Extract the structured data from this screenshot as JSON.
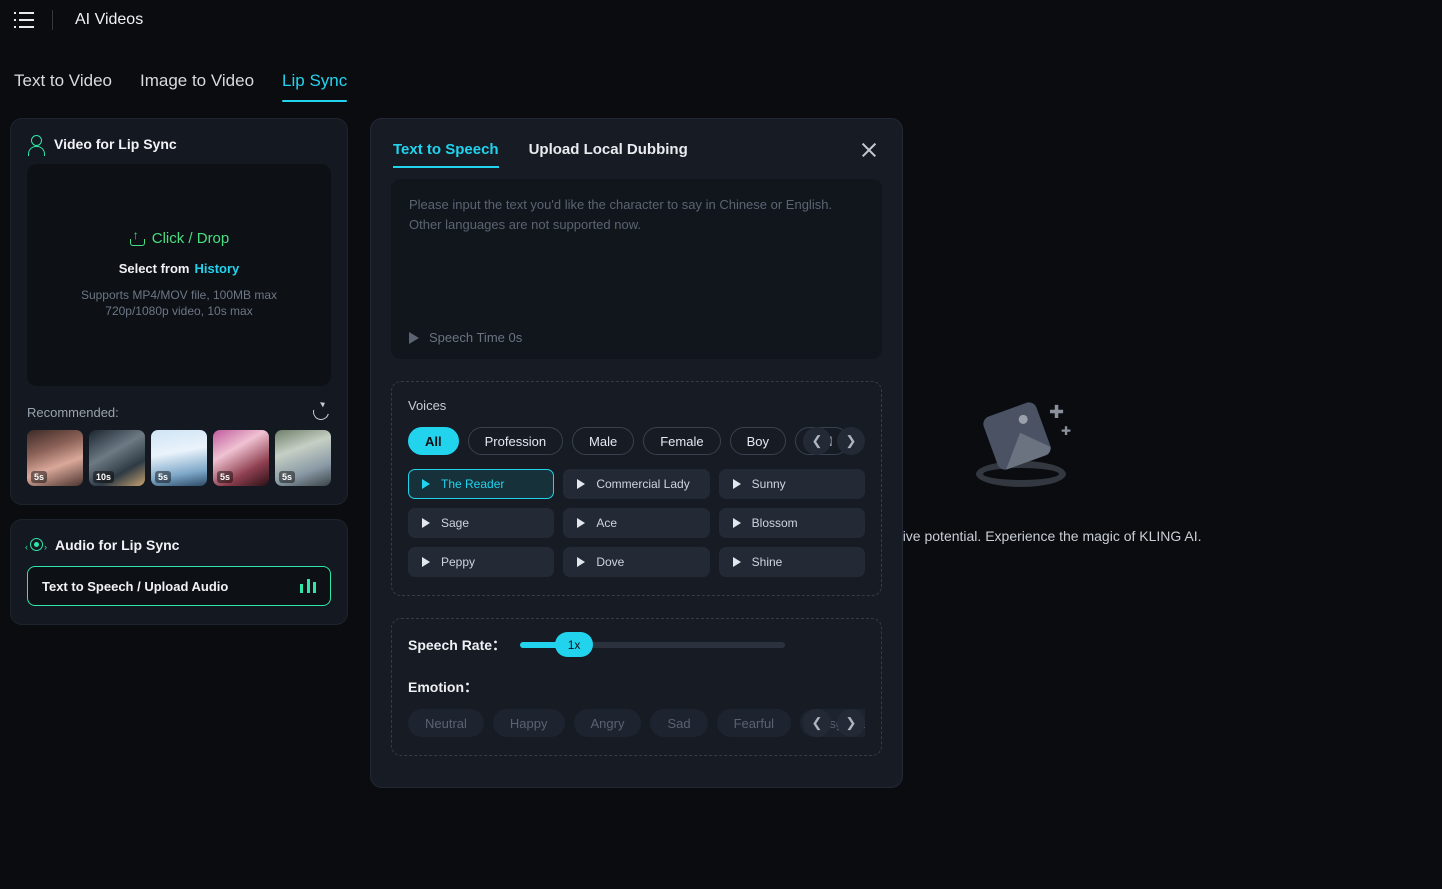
{
  "header": {
    "title": "AI Videos",
    "menu_icon": "list-menu-icon"
  },
  "tabs": [
    {
      "label": "Text to Video",
      "active": false
    },
    {
      "label": "Image to Video",
      "active": false
    },
    {
      "label": "Lip Sync",
      "active": true
    }
  ],
  "empty_state": {
    "text": "your creative potential. Experience the magic of KLING AI."
  },
  "video_panel": {
    "title": "Video for Lip Sync",
    "icon": "person-icon",
    "dropzone": {
      "main": "Click / Drop",
      "upload_icon": "upload-icon",
      "select_from": "Select from",
      "history_link": "History",
      "note_line1": "Supports MP4/MOV file, 100MB max",
      "note_line2": "720p/1080p video, 10s max"
    },
    "recommended_label": "Recommended:",
    "refresh_icon": "refresh-icon",
    "thumbnails": [
      {
        "duration": "5s"
      },
      {
        "duration": "10s"
      },
      {
        "duration": "5s"
      },
      {
        "duration": "5s"
      },
      {
        "duration": "5s"
      }
    ]
  },
  "audio_panel": {
    "title": "Audio for Lip Sync",
    "icon": "audio-wave-icon",
    "input_value": "Text to Speech / Upload Audio",
    "input_icon": "equalizer-icon"
  },
  "modal": {
    "tabs": [
      {
        "label": "Text to Speech",
        "active": true
      },
      {
        "label": "Upload Local Dubbing",
        "active": false
      }
    ],
    "close_icon": "close-icon",
    "textarea": {
      "placeholder": "Please input the text you'd like the character to say in Chinese or English. Other languages are not supported now.",
      "value": "",
      "play_icon": "play-icon",
      "speech_time": "Speech Time 0s"
    },
    "voices": {
      "title": "Voices",
      "filters": [
        {
          "label": "All",
          "active": true
        },
        {
          "label": "Profession",
          "active": false
        },
        {
          "label": "Male",
          "active": false
        },
        {
          "label": "Female",
          "active": false
        },
        {
          "label": "Boy",
          "active": false
        },
        {
          "label": "Girl",
          "active": false
        }
      ],
      "prev_icon": "chevron-left-icon",
      "next_icon": "chevron-right-icon",
      "list": [
        {
          "name": "The Reader",
          "active": true
        },
        {
          "name": "Commercial Lady",
          "active": false
        },
        {
          "name": "Sunny",
          "active": false
        },
        {
          "name": "Sage",
          "active": false
        },
        {
          "name": "Ace",
          "active": false
        },
        {
          "name": "Blossom",
          "active": false
        },
        {
          "name": "Peppy",
          "active": false
        },
        {
          "name": "Dove",
          "active": false
        },
        {
          "name": "Shine",
          "active": false
        }
      ]
    },
    "speech_rate": {
      "label": "Speech Rate：",
      "value": "1x"
    },
    "emotion": {
      "label": "Emotion：",
      "options": [
        {
          "label": "Neutral"
        },
        {
          "label": "Happy"
        },
        {
          "label": "Angry"
        },
        {
          "label": "Sad"
        },
        {
          "label": "Fearful"
        },
        {
          "label": "Disgusted"
        }
      ],
      "prev_icon": "chevron-left-icon",
      "next_icon": "chevron-right-icon"
    }
  },
  "colors": {
    "accent": "#22d3ee",
    "green": "#2ee6a8",
    "bright_green": "#4ade80",
    "bg": "#0a0c10"
  }
}
